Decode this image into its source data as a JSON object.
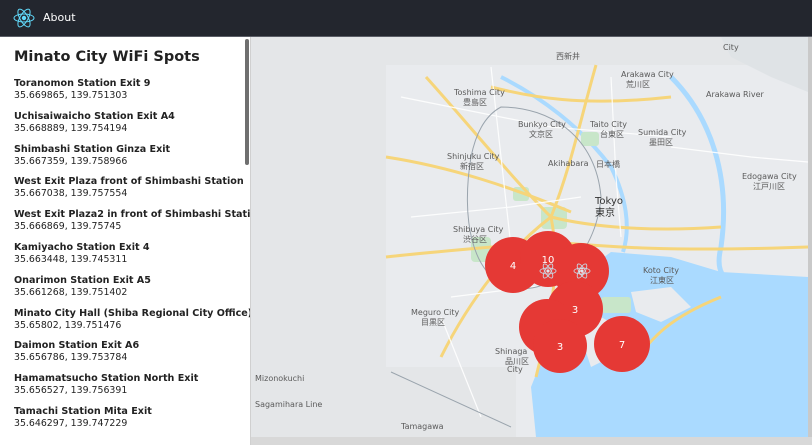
{
  "app": {
    "about_label": "About"
  },
  "sidebar": {
    "title": "Minato City WiFi Spots",
    "spots": [
      {
        "name": "Toranomon Station Exit 9",
        "coords": "35.669865, 139.751303"
      },
      {
        "name": "Uchisaiwaicho Station Exit A4",
        "coords": "35.668889, 139.754194"
      },
      {
        "name": "Shimbashi Station Ginza Exit",
        "coords": "35.667359, 139.758966"
      },
      {
        "name": "West Exit Plaza front of Shimbashi Station",
        "coords": "35.667038, 139.757554"
      },
      {
        "name": "West Exit Plaza2 in front of Shimbashi Station",
        "coords": "35.666869, 139.75745"
      },
      {
        "name": "Kamiyacho Station Exit 4",
        "coords": "35.663448, 139.745311"
      },
      {
        "name": "Onarimon Station Exit A5",
        "coords": "35.661268, 139.751402"
      },
      {
        "name": "Minato City Hall (Shiba Regional City Office)",
        "coords": "35.65802, 139.751476"
      },
      {
        "name": "Daimon Station Exit A6",
        "coords": "35.656786, 139.753784"
      },
      {
        "name": "Hamamatsucho Station North Exit",
        "coords": "35.656527, 139.756391"
      },
      {
        "name": "Tamachi Station Mita Exit",
        "coords": "35.646297, 139.747229"
      }
    ]
  },
  "map": {
    "places": {
      "arakawa": "Arakawa City",
      "arakawa_jp": "荒川区",
      "toshima": "Toshima City",
      "toshima_jp": "豊島区",
      "bunkyo": "Bunkyo City",
      "bunkyo_jp": "文京区",
      "taito": "Taito City",
      "taito_jp": "台東区",
      "sumida": "Sumida City",
      "sumida_jp": "墨田区",
      "shinjuku": "Shinjuku City",
      "shinjuku_jp": "新宿区",
      "akihabara": "Akihabara",
      "tokyo": "Tokyo",
      "tokyo_jp": "東京",
      "edogawa": "Edogawa City",
      "edogawa_jp": "江戸川区",
      "shibuya": "Shibuya City",
      "shibuya_jp": "渋谷区",
      "koto": "Koto City",
      "koto_jp": "江東区",
      "meguro": "Meguro City",
      "meguro_jp": "目黒区",
      "shinagawa": "Shinaga",
      "shinagawa_jp": "品川区",
      "shinagawa_city": "City",
      "mizonokuchi": "Mizonokuchi",
      "kotobuki": "日本橋",
      "nishiarai": "西新井",
      "city_corner": "City",
      "sagamihara": "Sagamihara Line",
      "arakawa_river": "Arakawa River",
      "tamagawa": "Tamagawa"
    },
    "clusters": [
      {
        "label": "4",
        "color": "#e53935"
      },
      {
        "label": "10",
        "color": "#e53935"
      },
      {
        "label": "6",
        "color": "#e53935"
      },
      {
        "label": "3",
        "color": "#e53935"
      },
      {
        "label": "3",
        "color": "#e53935"
      },
      {
        "label": "7",
        "color": "#e53935"
      }
    ],
    "colors": {
      "land": "#eceff1",
      "water": "#aadaff",
      "park": "#c8e6c9",
      "road": "#f9d77a",
      "marker": "#e53935"
    }
  }
}
